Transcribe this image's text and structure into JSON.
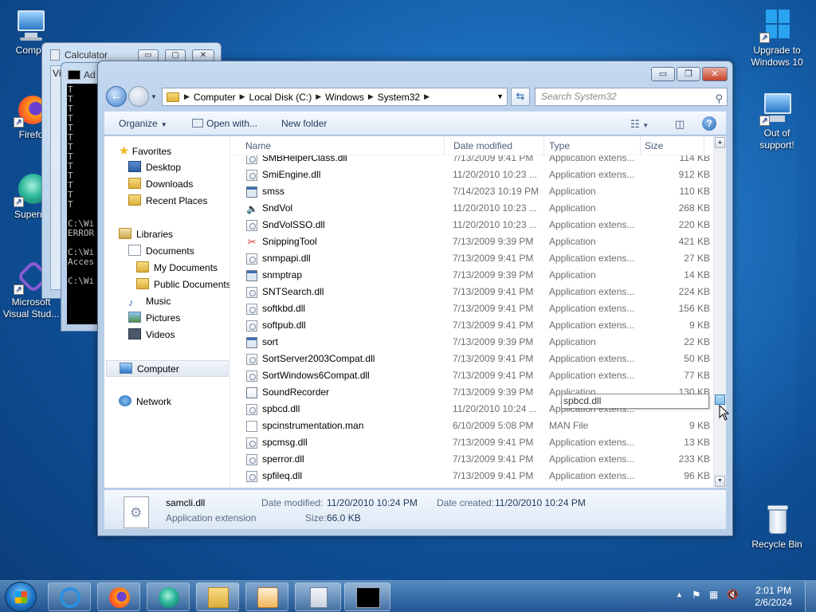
{
  "desktop": {
    "icons_left": [
      {
        "label": "Compu",
        "icon": "computer-icon"
      },
      {
        "label": "Firefo",
        "icon": "firefox-icon"
      },
      {
        "label": "Superm",
        "icon": "app-icon"
      },
      {
        "label": "Microsoft Visual Stud...",
        "icon": "visual-studio-icon"
      }
    ],
    "icons_right": [
      {
        "label": "Upgrade to Windows 10",
        "icon": "windows-logo-icon"
      },
      {
        "label": "Out of support!",
        "icon": "warning-computer-icon"
      },
      {
        "label": "Recycle Bin",
        "icon": "recycle-bin-icon"
      }
    ]
  },
  "calculator": {
    "title": "Calculator",
    "menu_fragment": "Vi"
  },
  "cmd": {
    "title": "Ad",
    "lines": "T\nT\nT\nT\nT\nT\nT\nT\nT\nT\nT\nT\nT\n\nC:\\Wi\nERROR\n\nC:\\Wi\nAcces\n\nC:\\Wi"
  },
  "explorer": {
    "controls": {
      "minimize": "▭",
      "maximize": "❐",
      "close": "✕"
    },
    "address": {
      "segments": [
        "Computer",
        "Local Disk (C:)",
        "Windows",
        "System32"
      ]
    },
    "search_placeholder": "Search System32",
    "commands": {
      "organize": "Organize",
      "open_with": "Open with...",
      "new_folder": "New folder"
    },
    "nav": {
      "favorites": "Favorites",
      "desktop": "Desktop",
      "downloads": "Downloads",
      "recent": "Recent Places",
      "libraries": "Libraries",
      "documents": "Documents",
      "my_documents": "My Documents",
      "public_documents": "Public Documents",
      "music": "Music",
      "pictures": "Pictures",
      "videos": "Videos",
      "computer": "Computer",
      "network": "Network"
    },
    "columns": {
      "name": "Name",
      "date": "Date modified",
      "type": "Type",
      "size": "Size"
    },
    "files": [
      {
        "name": "SMBHelperClass.dll",
        "date": "7/13/2009 9:41 PM",
        "type": "Application extens...",
        "size": "114 KB",
        "icon": "dll"
      },
      {
        "name": "SmiEngine.dll",
        "date": "11/20/2010 10:23 ...",
        "type": "Application extens...",
        "size": "912 KB",
        "icon": "dll"
      },
      {
        "name": "smss",
        "date": "7/14/2023 10:19 PM",
        "type": "Application",
        "size": "110 KB",
        "icon": "app"
      },
      {
        "name": "SndVol",
        "date": "11/20/2010 10:23 ...",
        "type": "Application",
        "size": "268 KB",
        "icon": "vol"
      },
      {
        "name": "SndVolSSO.dll",
        "date": "11/20/2010 10:23 ...",
        "type": "Application extens...",
        "size": "220 KB",
        "icon": "dll"
      },
      {
        "name": "SnippingTool",
        "date": "7/13/2009 9:39 PM",
        "type": "Application",
        "size": "421 KB",
        "icon": "snip"
      },
      {
        "name": "snmpapi.dll",
        "date": "7/13/2009 9:41 PM",
        "type": "Application extens...",
        "size": "27 KB",
        "icon": "dll"
      },
      {
        "name": "snmptrap",
        "date": "7/13/2009 9:39 PM",
        "type": "Application",
        "size": "14 KB",
        "icon": "app"
      },
      {
        "name": "SNTSearch.dll",
        "date": "7/13/2009 9:41 PM",
        "type": "Application extens...",
        "size": "224 KB",
        "icon": "dll"
      },
      {
        "name": "softkbd.dll",
        "date": "7/13/2009 9:41 PM",
        "type": "Application extens...",
        "size": "156 KB",
        "icon": "dll"
      },
      {
        "name": "softpub.dll",
        "date": "7/13/2009 9:41 PM",
        "type": "Application extens...",
        "size": "9 KB",
        "icon": "dll"
      },
      {
        "name": "sort",
        "date": "7/13/2009 9:39 PM",
        "type": "Application",
        "size": "22 KB",
        "icon": "app"
      },
      {
        "name": "SortServer2003Compat.dll",
        "date": "7/13/2009 9:41 PM",
        "type": "Application extens...",
        "size": "50 KB",
        "icon": "dll"
      },
      {
        "name": "SortWindows6Compat.dll",
        "date": "7/13/2009 9:41 PM",
        "type": "Application extens...",
        "size": "77 KB",
        "icon": "dll"
      },
      {
        "name": "SoundRecorder",
        "date": "7/13/2009 9:39 PM",
        "type": "Application",
        "size": "130 KB",
        "icon": "rec"
      },
      {
        "name": "spbcd.dll",
        "date": "11/20/2010 10:24 ...",
        "type": "Application extens...",
        "size": "",
        "icon": "dll"
      },
      {
        "name": "spcinstrumentation.man",
        "date": "6/10/2009 5:08 PM",
        "type": "MAN File",
        "size": "9 KB",
        "icon": "file"
      },
      {
        "name": "spcmsg.dll",
        "date": "7/13/2009 9:41 PM",
        "type": "Application extens...",
        "size": "13 KB",
        "icon": "dll"
      },
      {
        "name": "sperror.dll",
        "date": "7/13/2009 9:41 PM",
        "type": "Application extens...",
        "size": "233 KB",
        "icon": "dll"
      },
      {
        "name": "spfileq.dll",
        "date": "7/13/2009 9:41 PM",
        "type": "Application extens...",
        "size": "96 KB",
        "icon": "dll"
      }
    ],
    "tooltip": "spbcd.dll",
    "details": {
      "filename": "samcli.dll",
      "filetype": "Application extension",
      "modified_label": "Date modified:",
      "modified_value": "11/20/2010 10:24 PM",
      "created_label": "Date created:",
      "created_value": "11/20/2010 10:24 PM",
      "size_label": "Size:",
      "size_value": "66.0 KB"
    }
  },
  "taskbar": {
    "buttons": [
      "internet-explorer-icon",
      "firefox-icon",
      "app-icon",
      "file-explorer-icon",
      "media-player-icon",
      "calculator-icon",
      "cmd-icon"
    ],
    "time": "2:01 PM",
    "date": "2/6/2024"
  }
}
